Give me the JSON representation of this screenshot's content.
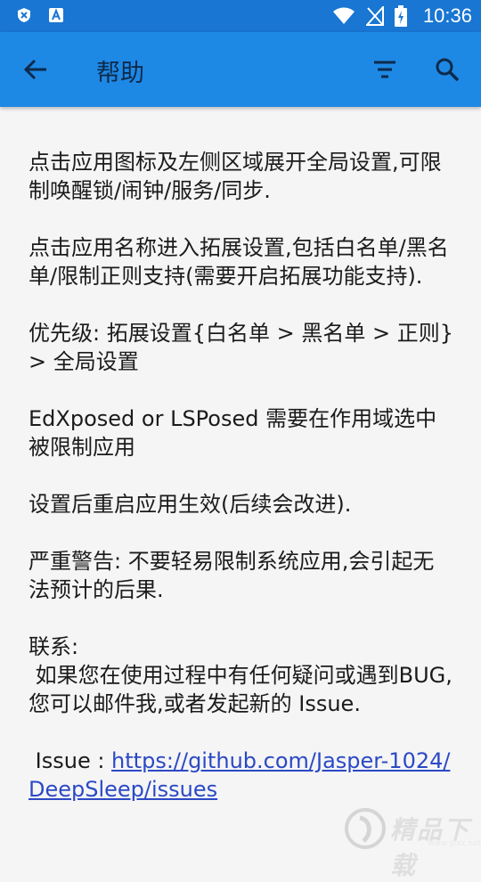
{
  "status_bar": {
    "time": "10:36",
    "left_icons": [
      "shield-x-icon",
      "android-a-icon"
    ],
    "right_icons": [
      "wifi-icon",
      "no-signal-icon",
      "battery-charging-icon"
    ]
  },
  "app_bar": {
    "title": "帮助",
    "back_icon": "arrow-left-icon",
    "filter_icon": "filter-icon",
    "search_icon": "search-icon",
    "color": "#1e88e5"
  },
  "help": {
    "p1": "点击应用图标及左侧区域展开全局设置,可限制唤醒锁/闹钟/服务/同步.",
    "p2": "点击应用名称进入拓展设置,包括白名单/黑名单/限制正则支持(需要开启拓展功能支持).",
    "p3": "优先级: 拓展设置{白名单 > 黑名单 > 正则} > 全局设置",
    "p4": "EdXposed or LSPosed 需要在作用域选中被限制应用",
    "p5": "设置后重启应用生效(后续会改进).",
    "p6": "严重警告: 不要轻易限制系统应用,会引起无法预计的后果.",
    "contact_label": "联系:",
    "contact_body": " 如果您在使用过程中有任何疑问或遇到BUG,您可以邮件我,或者发起新的 Issue.",
    "issue_label": " Issue : ",
    "issue_link": "https://github.com/Jasper-1024/DeepSleep/issues"
  },
  "watermark": {
    "text": "精品下载",
    "sub": "www.jpxz.net"
  }
}
